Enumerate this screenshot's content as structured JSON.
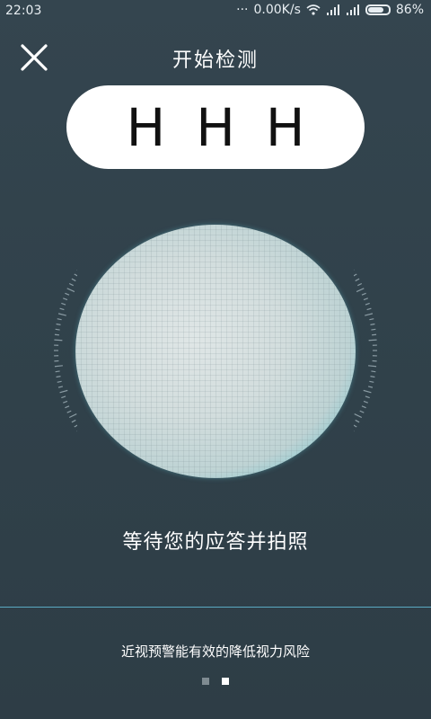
{
  "status_bar": {
    "time": "22:03",
    "network_speed": "0.00K/s",
    "battery": "86%"
  },
  "header": {
    "title": "开始检测",
    "close_icon": "close-icon"
  },
  "test_letters": [
    "H",
    "H",
    "H"
  ],
  "camera": {
    "wait_message": "等待您的应答并拍照"
  },
  "footer": {
    "tip": "近视预警能有效的降低视力风险",
    "pages": {
      "total": 2,
      "current": 2
    }
  },
  "colors": {
    "background": "#30414a",
    "accent": "#5aa9c2",
    "camera_ring": "#4fb7c4"
  }
}
